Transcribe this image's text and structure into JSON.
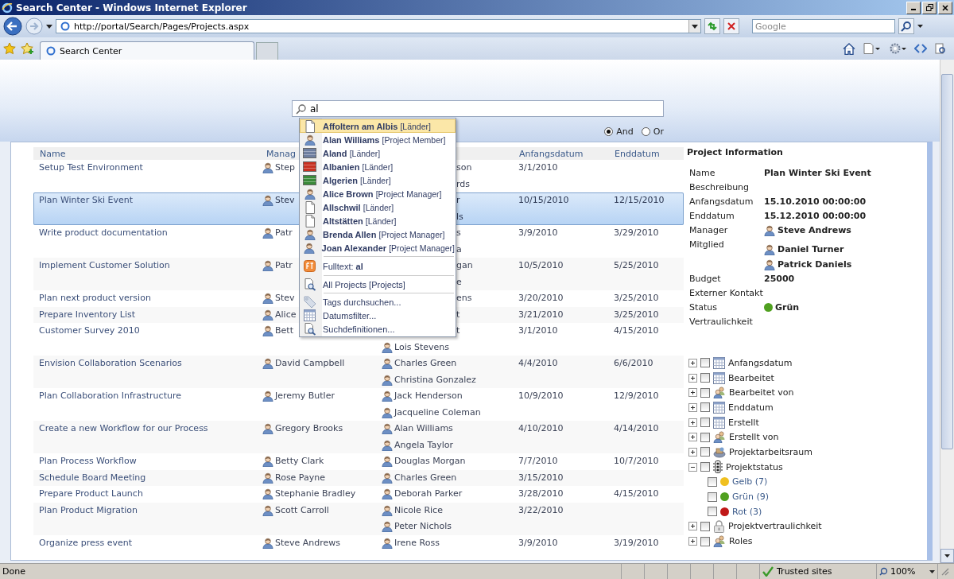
{
  "window": {
    "title": "Search Center - Windows Internet Explorer"
  },
  "address_bar": {
    "url": "http://portal/Search/Pages/Projects.aspx"
  },
  "browser_search": {
    "placeholder": "Google"
  },
  "tabs": [
    {
      "label": "Search Center",
      "selected": true
    }
  ],
  "search": {
    "value": "al",
    "operators": [
      {
        "label": "And",
        "selected": true
      },
      {
        "label": "Or",
        "selected": false
      }
    ]
  },
  "suggestions": {
    "items": [
      {
        "kind": "document",
        "name": "Affoltern am Albis",
        "tag": "[Länder]",
        "selected": true
      },
      {
        "kind": "person",
        "name": "Alan Williams",
        "tag": "[Project Member]",
        "selected": false
      },
      {
        "kind": "flag",
        "name": "Aland",
        "tag": "[Länder]",
        "color": "#6f7fa0",
        "selected": false
      },
      {
        "kind": "flag",
        "name": "Albanien",
        "tag": "[Länder]",
        "color": "#c83020",
        "selected": false
      },
      {
        "kind": "flag",
        "name": "Algerien",
        "tag": "[Länder]",
        "color": "#3a8a3a",
        "selected": false
      },
      {
        "kind": "person",
        "name": "Alice Brown",
        "tag": "[Project Manager]",
        "selected": false
      },
      {
        "kind": "document",
        "name": "Allschwil",
        "tag": "[Länder]",
        "selected": false
      },
      {
        "kind": "document",
        "name": "Altstätten",
        "tag": "[Länder]",
        "selected": false
      },
      {
        "kind": "person",
        "name": "Brenda Allen",
        "tag": "[Project Manager]",
        "selected": false
      },
      {
        "kind": "person",
        "name": "Joan Alexander",
        "tag": "[Project Manager]",
        "selected": false
      }
    ],
    "fulltext": "Fulltext: **al**",
    "scopes": [
      "All Projects [Projects]"
    ],
    "actions": [
      {
        "kind": "tag",
        "label": "Tags durchsuchen..."
      },
      {
        "kind": "calendar",
        "label": "Datumsfilter..."
      },
      {
        "kind": "search-scope",
        "label": "Suchdefinitionen..."
      }
    ]
  },
  "table": {
    "columns": [
      "Name",
      "Manag",
      "Anfangsdatum",
      "Enddatum"
    ],
    "rows": [
      {
        "name": "Setup Test Environment",
        "manager": "Step",
        "members": [
          {
            "name": "son",
            "clipped": true
          },
          {
            "name": "rds",
            "clipped": true
          }
        ],
        "start": "3/1/2010",
        "selected": false
      },
      {
        "name": "Plan Winter Ski Event",
        "manager": "Stev",
        "members": [
          {
            "name": "r",
            "clipped": true
          },
          {
            "name": "ls",
            "clipped": true
          }
        ],
        "start": "10/15/2010",
        "end": "12/15/2010",
        "selected": true
      },
      {
        "name": "Write product documentation",
        "manager": "Patr",
        "members": [
          {
            "name": "s",
            "clipped": true
          },
          {
            "name": "a",
            "clipped": true
          }
        ],
        "start": "3/9/2010",
        "end": "3/29/2010",
        "selected": false
      },
      {
        "name": "Implement Customer Solution",
        "manager": "Patr",
        "members": [
          {
            "name": "gan",
            "clipped": true
          },
          {
            "name": "e",
            "clipped": true
          }
        ],
        "start": "10/5/2010",
        "end": "5/25/2010",
        "selected": false
      },
      {
        "name": "Plan next product version",
        "manager": "Stev",
        "members": [
          {
            "name": "ens",
            "clipped": true
          }
        ],
        "start": "3/20/2010",
        "end": "3/25/2010",
        "selected": false
      },
      {
        "name": "Prepare Inventory List",
        "manager": "Alice",
        "members": [
          {
            "name": "t",
            "clipped": true
          }
        ],
        "start": "3/21/2010",
        "end": "3/25/2010",
        "selected": false
      },
      {
        "name": "Customer Survey 2010",
        "manager": "Bett",
        "members": [
          {
            "name": "t",
            "clipped": true
          },
          {
            "name": "Lois Stevens",
            "clipped": false
          }
        ],
        "start": "3/1/2010",
        "end": "4/15/2010",
        "selected": false
      },
      {
        "name": "Envision Collaboration Scenarios",
        "manager": "David Campbell",
        "members": [
          {
            "name": "Charles Green",
            "clipped": false
          },
          {
            "name": "Christina Gonzalez",
            "clipped": false
          }
        ],
        "start": "4/4/2010",
        "end": "6/6/2010",
        "selected": false
      },
      {
        "name": "Plan Collaboration Infrastructure",
        "manager": "Jeremy Butler",
        "members": [
          {
            "name": "Jack Henderson",
            "clipped": false
          },
          {
            "name": "Jacqueline Coleman",
            "clipped": false
          }
        ],
        "start": "10/9/2010",
        "end": "12/9/2010",
        "selected": false
      },
      {
        "name": "Create a new Workflow for our Process",
        "manager": "Gregory Brooks",
        "members": [
          {
            "name": "Alan Williams",
            "clipped": false
          },
          {
            "name": "Angela Taylor",
            "clipped": false
          }
        ],
        "start": "4/10/2010",
        "end": "4/14/2010",
        "selected": false
      },
      {
        "name": "Plan Process Workflow",
        "manager": "Betty Clark",
        "members": [
          {
            "name": "Douglas Morgan",
            "clipped": false
          }
        ],
        "start": "7/7/2010",
        "end": "10/7/2010",
        "selected": false
      },
      {
        "name": "Schedule Board Meeting",
        "manager": "Rose Payne",
        "members": [
          {
            "name": "Charles Green",
            "clipped": false
          }
        ],
        "start": "3/15/2010",
        "selected": false
      },
      {
        "name": "Prepare Product Launch",
        "manager": "Stephanie Bradley",
        "members": [
          {
            "name": "Deborah Parker",
            "clipped": false
          }
        ],
        "start": "3/28/2010",
        "end": "4/15/2010",
        "selected": false
      },
      {
        "name": "Plan Product Migration",
        "manager": "Scott Carroll",
        "members": [
          {
            "name": "Nicole Rice",
            "clipped": false
          },
          {
            "name": "Peter Nichols",
            "clipped": false
          }
        ],
        "start": "3/22/2010",
        "selected": false
      },
      {
        "name": "Organize press event",
        "manager": "Steve Andrews",
        "members": [
          {
            "name": "Irene Ross",
            "clipped": false
          }
        ],
        "start": "3/9/2010",
        "end": "3/19/2010",
        "selected": false
      }
    ]
  },
  "project_info": {
    "title": "Project Information",
    "fields": [
      {
        "label": "Name",
        "value": "Plan Winter Ski Event"
      },
      {
        "label": "Beschreibung"
      },
      {
        "label": "Anfangsdatum",
        "value": "15.10.2010 00:00:00"
      },
      {
        "label": "Enddatum",
        "value": "15.12.2010 00:00:00"
      },
      {
        "label": "Manager",
        "people": [
          "Steve Andrews"
        ]
      },
      {
        "label": "Mitglied",
        "people": [
          "Daniel Turner",
          "Patrick Daniels"
        ]
      },
      {
        "label": "Budget",
        "value": "25000"
      },
      {
        "label": "Externer Kontakt"
      },
      {
        "label": "Status",
        "value": "Grün",
        "color": "#50a020"
      },
      {
        "label": "Vertraulichkeit"
      }
    ]
  },
  "refiners": [
    {
      "kind": "calendar",
      "label": "Anfangsdatum",
      "expanded": false,
      "checked": false
    },
    {
      "kind": "calendar",
      "label": "Bearbeitet",
      "expanded": false,
      "checked": false
    },
    {
      "kind": "people",
      "label": "Bearbeitet von",
      "expanded": false,
      "checked": false
    },
    {
      "kind": "calendar",
      "label": "Enddatum",
      "expanded": false,
      "checked": false
    },
    {
      "kind": "calendar",
      "label": "Erstellt",
      "expanded": false,
      "checked": false
    },
    {
      "kind": "people",
      "label": "Erstellt von",
      "expanded": false,
      "checked": false
    },
    {
      "kind": "workspace",
      "label": "Projektarbeitsraum",
      "expanded": false,
      "checked": false
    },
    {
      "kind": "status",
      "label": "Projektstatus",
      "expanded": true,
      "checked": false,
      "children": [
        {
          "label": "Gelb (7)",
          "color": "#f0c020",
          "checked": false
        },
        {
          "label": "Grün (9)",
          "color": "#50a020",
          "checked": false
        },
        {
          "label": "Rot (3)",
          "color": "#c01818",
          "checked": false
        }
      ]
    },
    {
      "kind": "lock",
      "label": "Projektvertraulichkeit",
      "expanded": false,
      "checked": false
    },
    {
      "kind": "people",
      "label": "Roles",
      "expanded": false,
      "checked": false
    }
  ],
  "status_bar": {
    "text": "Done",
    "zone": "Trusted sites",
    "zoom": "100%"
  }
}
